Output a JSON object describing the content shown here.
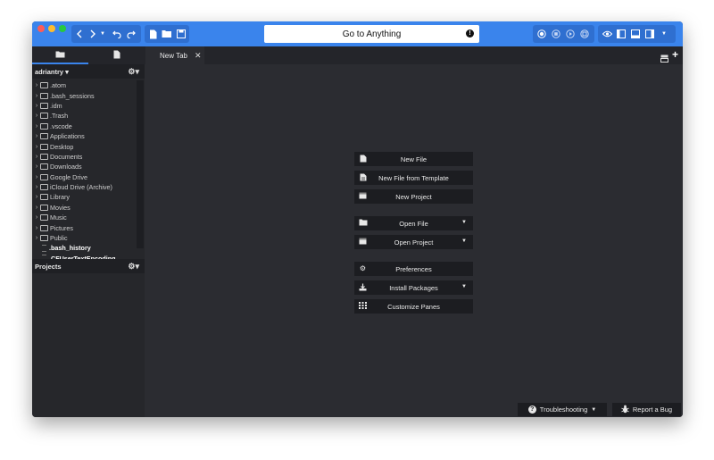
{
  "titlebar": {
    "goto_placeholder": "Go to Anything",
    "colors": {
      "accent": "#3a84ec",
      "close": "#fc5c57",
      "minimize": "#fdbc2e",
      "zoom": "#27c840"
    }
  },
  "tabs": {
    "editor_tab_label": "New Tab",
    "close_glyph": "✕"
  },
  "sidebar": {
    "places_label": "adriantry ▾",
    "projects_label": "Projects",
    "gear_glyph": "⚙▾",
    "items": [
      {
        "label": ".atom",
        "kind": "folder"
      },
      {
        "label": ".bash_sessions",
        "kind": "folder"
      },
      {
        "label": ".idm",
        "kind": "folder"
      },
      {
        "label": ".Trash",
        "kind": "folder"
      },
      {
        "label": ".vscode",
        "kind": "folder"
      },
      {
        "label": "Applications",
        "kind": "folder"
      },
      {
        "label": "Desktop",
        "kind": "folder"
      },
      {
        "label": "Documents",
        "kind": "folder"
      },
      {
        "label": "Downloads",
        "kind": "folder"
      },
      {
        "label": "Google Drive",
        "kind": "folder"
      },
      {
        "label": "iCloud Drive (Archive)",
        "kind": "folder"
      },
      {
        "label": "Library",
        "kind": "folder"
      },
      {
        "label": "Movies",
        "kind": "folder"
      },
      {
        "label": "Music",
        "kind": "folder"
      },
      {
        "label": "Pictures",
        "kind": "folder"
      },
      {
        "label": "Public",
        "kind": "folder"
      },
      {
        "label": ".bash_history",
        "kind": "file"
      },
      {
        "label": ".CFUserTextEncoding",
        "kind": "file"
      }
    ]
  },
  "quick_start": {
    "new_file": "New File",
    "new_file_from_template": "New File from Template",
    "new_project": "New Project",
    "open_file": "Open File",
    "open_project": "Open Project",
    "preferences": "Preferences",
    "install_packages": "Install Packages",
    "customize_panes": "Customize Panes"
  },
  "footer": {
    "troubleshooting": "Troubleshooting",
    "report_bug": "Report a Bug"
  }
}
